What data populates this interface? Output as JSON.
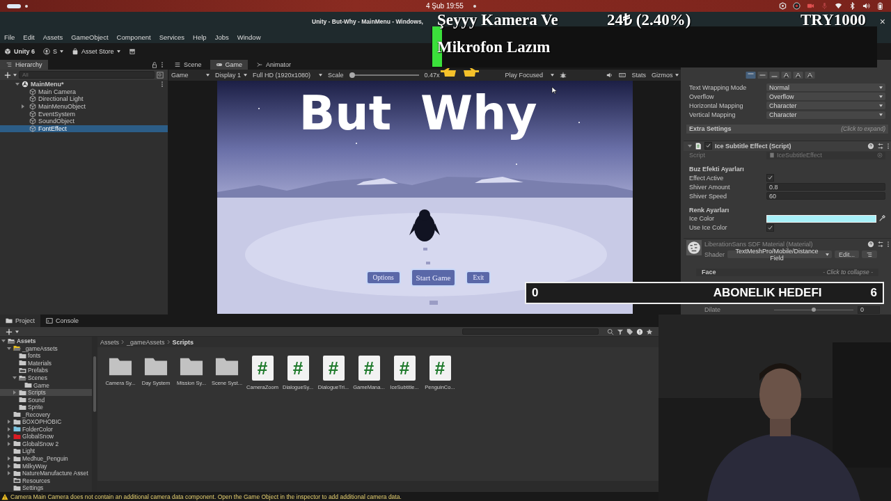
{
  "os_bar": {
    "clock": "4 Şub 19:55"
  },
  "window": {
    "title": "Unity - But-Why - MainMenu - Windows,",
    "close": "×"
  },
  "menu": [
    "File",
    "Edit",
    "Assets",
    "GameObject",
    "Component",
    "Services",
    "Help",
    "Jobs",
    "Window"
  ],
  "toolbar": {
    "account": "Unity 6",
    "user": "S",
    "store": "Asset Store"
  },
  "hierarchy": {
    "tab": "Hierarchy",
    "search_placeholder": "All",
    "scene": "MainMenu*",
    "items": [
      {
        "label": "Main Camera",
        "selected": false
      },
      {
        "label": "Directional Light",
        "selected": false
      },
      {
        "label": "MainMenuObject",
        "selected": false,
        "expanded": false
      },
      {
        "label": "EventSystem",
        "selected": false
      },
      {
        "label": "SoundObject",
        "selected": false
      },
      {
        "label": "FontEffect",
        "selected": true
      }
    ]
  },
  "center_tabs": [
    {
      "label": "Scene",
      "selected": false
    },
    {
      "label": "Game",
      "selected": true
    },
    {
      "label": "Animator",
      "selected": false
    }
  ],
  "game_toolbar": {
    "mode": "Game",
    "display": "Display 1",
    "resolution": "Full HD (1920x1080)",
    "scale_label": "Scale",
    "level": 0.0,
    "scale": "0.47x",
    "play_mode": "Play Focused",
    "stats": "Stats",
    "gizmos": "Gizmos"
  },
  "game": {
    "title": "But Why",
    "buttons": [
      {
        "label": "Options",
        "primary": false
      },
      {
        "label": "Start Game",
        "primary": true
      },
      {
        "label": "Exit",
        "primary": false
      }
    ]
  },
  "inspector": {
    "alignment": [
      {
        "selected": true
      },
      {
        "selected": false
      },
      {
        "selected": false
      },
      {
        "selected": false
      },
      {
        "selected": false
      },
      {
        "selected": false
      }
    ],
    "rows": [
      {
        "kind": "dropdown",
        "label": "Text Wrapping Mode",
        "value": "Normal"
      },
      {
        "kind": "dropdown",
        "label": "Overflow",
        "value": "Overflow"
      },
      {
        "kind": "dropdown",
        "label": "Horizontal Mapping",
        "value": "Character"
      },
      {
        "kind": "dropdown",
        "label": "Vertical Mapping",
        "value": "Character"
      },
      {
        "kind": "foldout",
        "label": "Extra Settings",
        "hint": "(Click to expand)"
      },
      {
        "kind": "component",
        "label": "Ice Subtitle Effect (Script)",
        "enabled": true
      },
      {
        "kind": "object",
        "label": "Script",
        "value": "IceSubtitleEffect"
      },
      {
        "kind": "section",
        "label": "Buz Efekti Ayarları"
      },
      {
        "kind": "checkbox",
        "label": "Effect Active",
        "checked": true
      },
      {
        "kind": "number",
        "label": "Shiver Amount",
        "value": "0.8"
      },
      {
        "kind": "number",
        "label": "Shiver Speed",
        "value": "60"
      },
      {
        "kind": "section",
        "label": "Renk Ayarları"
      },
      {
        "kind": "color",
        "label": "Ice Color",
        "color": "#a8f0f8"
      },
      {
        "kind": "checkbox",
        "label": "Use Ice Color",
        "checked": true
      },
      {
        "kind": "material",
        "label": "LiberationSans SDF Material (Material)",
        "shader_label": "Shader",
        "shader": "TextMeshPro/Mobile/Distance Field",
        "edit": "Edit..."
      },
      {
        "kind": "face",
        "label": "Face",
        "hint": "- Click to collapse -"
      },
      {
        "kind": "slider",
        "label": "Dilate",
        "value": "0",
        "level": 0.5
      }
    ]
  },
  "project": {
    "tabs": [
      {
        "label": "Project",
        "selected": true
      },
      {
        "label": "Console",
        "selected": false
      }
    ],
    "tree": [
      {
        "label": "Assets",
        "kind": "open",
        "color": "#c8c8c8",
        "selected": false,
        "expanded": true,
        "children": [
          {
            "label": "_gameAssets",
            "kind": "open",
            "color": "#e8c020",
            "selected": false,
            "expanded": true,
            "children": [
              {
                "label": "fonts",
                "kind": "folder",
                "color": "#c8c8c8",
                "selected": false
              },
              {
                "label": "Materials",
                "kind": "folder",
                "color": "#c8c8c8",
                "selected": false
              },
              {
                "label": "Prefabs",
                "kind": "empty",
                "color": "#c8c8c8",
                "selected": false
              },
              {
                "label": "Scenes",
                "kind": "open",
                "color": "#c8c8c8",
                "selected": false,
                "expanded": true,
                "children": [
                  {
                    "label": "Game",
                    "kind": "folder",
                    "color": "#c8c8c8",
                    "selected": false
                  }
                ]
              },
              {
                "label": "Scripts",
                "kind": "folder",
                "color": "#c8c8c8",
                "selected": true,
                "expanded": false
              },
              {
                "label": "Sound",
                "kind": "folder",
                "color": "#c8c8c8",
                "selected": false
              },
              {
                "label": "Sprite",
                "kind": "folder",
                "color": "#c8c8c8",
                "selected": false
              }
            ]
          },
          {
            "label": "_Recovery",
            "kind": "folder",
            "color": "#c8c8c8",
            "selected": false
          },
          {
            "label": "BOXOPHOBIC",
            "kind": "folder",
            "color": "#c8c8c8",
            "selected": false,
            "expanded": false
          },
          {
            "label": "FolderColor",
            "kind": "folder",
            "color": "#7cc4e0",
            "selected": false,
            "expanded": false
          },
          {
            "label": "GlobalSnow",
            "kind": "folder",
            "color": "#d81c24",
            "selected": false,
            "expanded": false
          },
          {
            "label": "GlobalSnow 2",
            "kind": "folder",
            "color": "#c8c8c8",
            "selected": false,
            "expanded": false
          },
          {
            "label": "Light",
            "kind": "folder",
            "color": "#c8c8c8",
            "selected": false
          },
          {
            "label": "Medhue_Penguin",
            "kind": "folder",
            "color": "#c8c8c8",
            "selected": false,
            "expanded": false
          },
          {
            "label": "MilkyWay",
            "kind": "folder",
            "color": "#c8c8c8",
            "selected": false,
            "expanded": false
          },
          {
            "label": "NatureManufacture Asset",
            "kind": "folder",
            "color": "#c8c8c8",
            "selected": false,
            "expanded": false
          },
          {
            "label": "Resources",
            "kind": "empty",
            "color": "#c8c8c8",
            "selected": false
          },
          {
            "label": "Settings",
            "kind": "folder",
            "color": "#c8c8c8",
            "selected": false
          }
        ]
      }
    ],
    "breadcrumb": [
      "Assets",
      "_gameAssets",
      "Scripts"
    ],
    "assets": [
      {
        "kind": "folder",
        "label": "Camera Sy..."
      },
      {
        "kind": "folder",
        "label": "Day System"
      },
      {
        "kind": "folder",
        "label": "Mission Sy..."
      },
      {
        "kind": "folder",
        "label": "Scene Syst..."
      },
      {
        "kind": "script",
        "label": "CameraZoom",
        "glyph": "#"
      },
      {
        "kind": "script",
        "label": "DialogueSy...",
        "glyph": "#"
      },
      {
        "kind": "script",
        "label": "DialogueTri...",
        "glyph": "#"
      },
      {
        "kind": "script",
        "label": "GameMana...",
        "glyph": "#"
      },
      {
        "kind": "script",
        "label": "IceSubtitle...",
        "glyph": "#"
      },
      {
        "kind": "script",
        "label": "PenguinCo...",
        "glyph": "#"
      }
    ]
  },
  "status_bar": {
    "message": "Camera Main Camera does not contain an additional camera data component. Open the Game Object in the inspector to add additional camera data."
  },
  "stream_overlay": {
    "alert": [
      "Şeyyy Kamera Ve",
      "Mikrofon Lazım"
    ],
    "donation": "24₺ (2.40%)",
    "goal": "TRY1000",
    "subscriber_goal": {
      "current": "0",
      "label": "ABONELIK HEDEFI",
      "target": "6"
    }
  },
  "webcam": {
    "kind": "picture"
  }
}
